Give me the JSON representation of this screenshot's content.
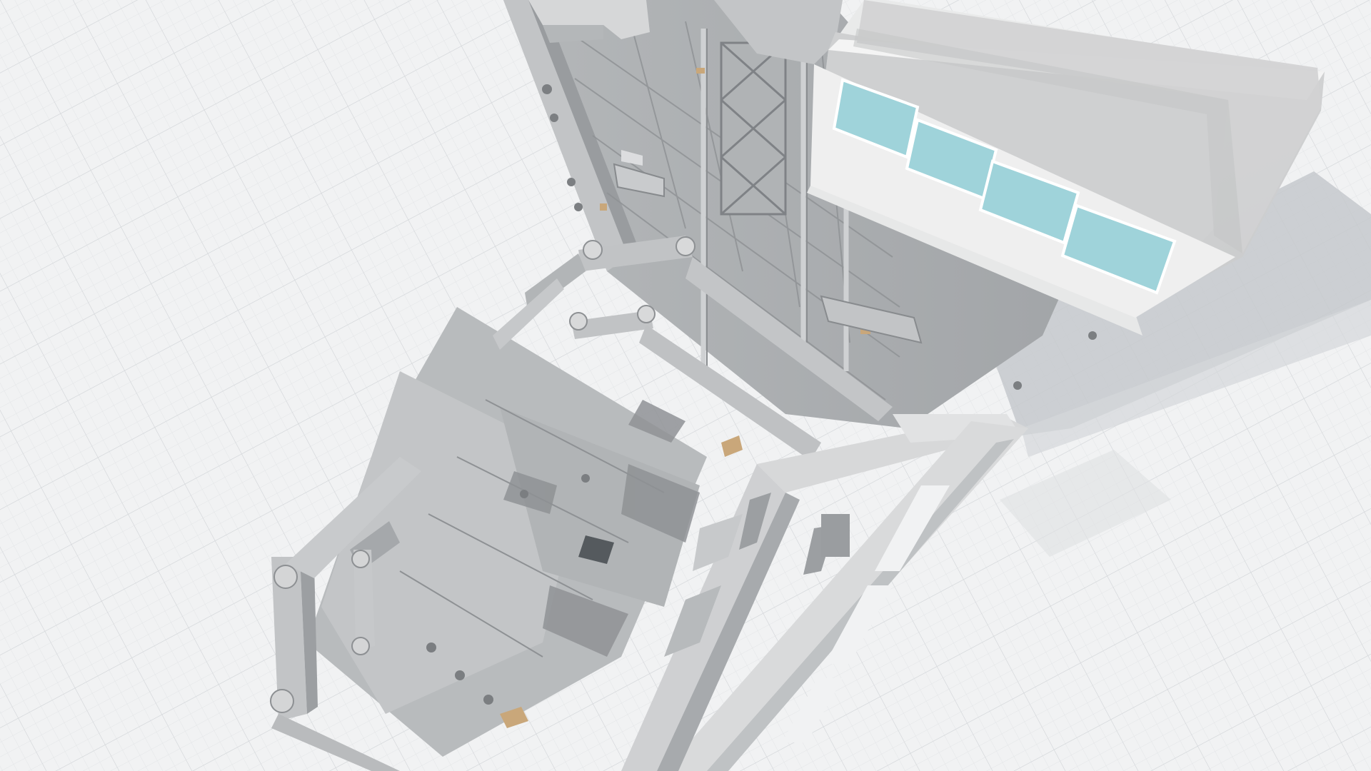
{
  "viewport": {
    "background_color": "#f1f2f3",
    "grid_minor_color": "#e3e5e7",
    "grid_major_color": "#d3d6d9",
    "shadow_color": "#bfc2c5"
  },
  "model": {
    "body_color": "#a9acae",
    "panel_dark_color": "#9a9da0",
    "panel_light_color": "#c7c9cb",
    "highlight_color": "#e0e1e2",
    "roof_color": "#d3d4d5",
    "roof_side_color": "#f3f3f3",
    "window_color": "#9fd3da",
    "accent_color": "#c9a77a"
  }
}
